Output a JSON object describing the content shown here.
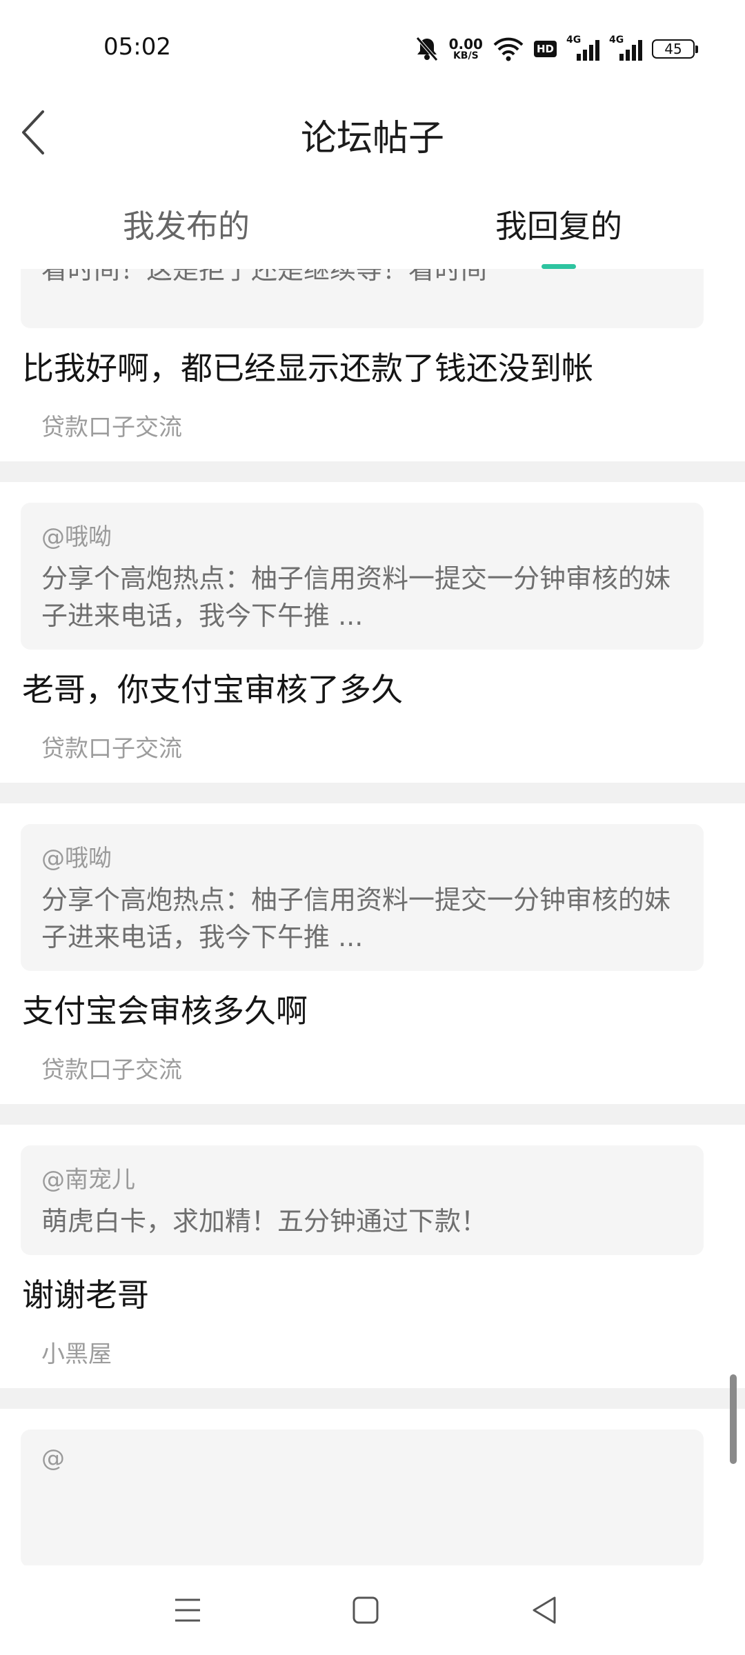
{
  "status_bar": {
    "time": "05:02",
    "net_speed_value": "0.00",
    "net_speed_unit": "KB/S",
    "hd_label": "HD",
    "signal1_label": "4G",
    "signal2_label": "4G",
    "battery_level": "45"
  },
  "header": {
    "title": "论坛帖子"
  },
  "tabs": [
    {
      "label": "我发布的",
      "active": false
    },
    {
      "label": "我回复的",
      "active": true
    }
  ],
  "items": [
    {
      "quote_text": "看时间！这是拒了还是继续等！看时间",
      "reply": "比我好啊，都已经显示还款了钱还没到帐",
      "forum": "贷款口子交流"
    },
    {
      "mention": "@哦呦",
      "quote_text": "分享个高炮热点：柚子信用资料一提交一分钟审核的妹子进来电话，我今下午推 ...",
      "reply": "老哥，你支付宝审核了多久",
      "forum": "贷款口子交流"
    },
    {
      "mention": "@哦呦",
      "quote_text": "分享个高炮热点：柚子信用资料一提交一分钟审核的妹子进来电话，我今下午推 ...",
      "reply": "支付宝会审核多久啊",
      "forum": "贷款口子交流"
    },
    {
      "mention": "@南⁣宠儿",
      "quote_text": "萌虎白卡，求加精！五分钟通过下款！",
      "reply": "谢谢老哥",
      "forum": "小黑屋"
    },
    {
      "mention": "@"
    }
  ],
  "colors": {
    "accent": "#2ec4a0",
    "quote_bg": "#f5f5f5",
    "divider": "#f1f1f1"
  }
}
